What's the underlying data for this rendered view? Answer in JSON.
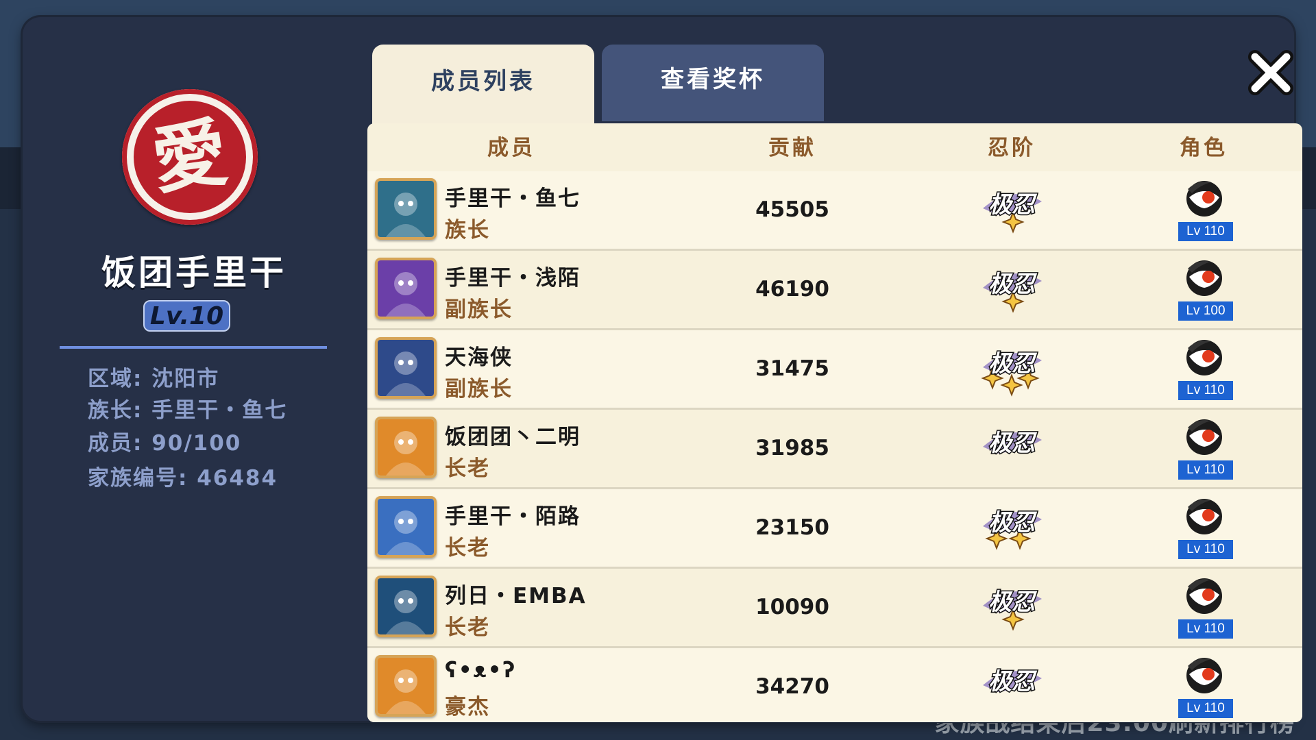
{
  "background_text": "家族战结束后23:00刷新排行榜",
  "clan": {
    "emblem_char": "愛",
    "name": "饭团手里干",
    "level": "Lv.10",
    "info": {
      "region": "区域: 沈阳市",
      "leader": "族长: 手里干・鱼七",
      "members": "成员: 90/100",
      "clan_id": "家族编号: 46484"
    }
  },
  "tabs": [
    {
      "label": "成员列表",
      "active": true
    },
    {
      "label": "查看奖杯",
      "active": false
    }
  ],
  "close_icon": "close-icon",
  "table": {
    "headers": {
      "member": "成员",
      "contribution": "贡献",
      "rank": "忍阶",
      "character": "角色"
    },
    "rank_badge_text": "极忍",
    "rows": [
      {
        "name": "手里干・鱼七",
        "role": "族长",
        "contribution": "45505",
        "stars": 1,
        "char_level": "Lv 110",
        "avatar_color": "#2f6f8a"
      },
      {
        "name": "手里干・浅陌",
        "role": "副族长",
        "contribution": "46190",
        "stars": 1,
        "char_level": "Lv 100",
        "avatar_color": "#6b3fa8"
      },
      {
        "name": "天海侠",
        "role": "副族长",
        "contribution": "31475",
        "stars": 3,
        "char_level": "Lv 110",
        "avatar_color": "#2e4a8a"
      },
      {
        "name": "饭团团丶二明",
        "role": "长老",
        "contribution": "31985",
        "stars": 0,
        "char_level": "Lv 110",
        "avatar_color": "#e08a2a"
      },
      {
        "name": "手里干・陌路",
        "role": "长老",
        "contribution": "23150",
        "stars": 2,
        "char_level": "Lv 110",
        "avatar_color": "#3a6fc0"
      },
      {
        "name": "列日・EMBA",
        "role": "长老",
        "contribution": "10090",
        "stars": 1,
        "char_level": "Lv 110",
        "avatar_color": "#1f4f7a"
      },
      {
        "name": "ʕ•ᴥ•ʔ",
        "role": "豪杰",
        "contribution": "34270",
        "stars": 0,
        "char_level": "Lv 110",
        "avatar_color": "#e08a2a"
      }
    ]
  }
}
